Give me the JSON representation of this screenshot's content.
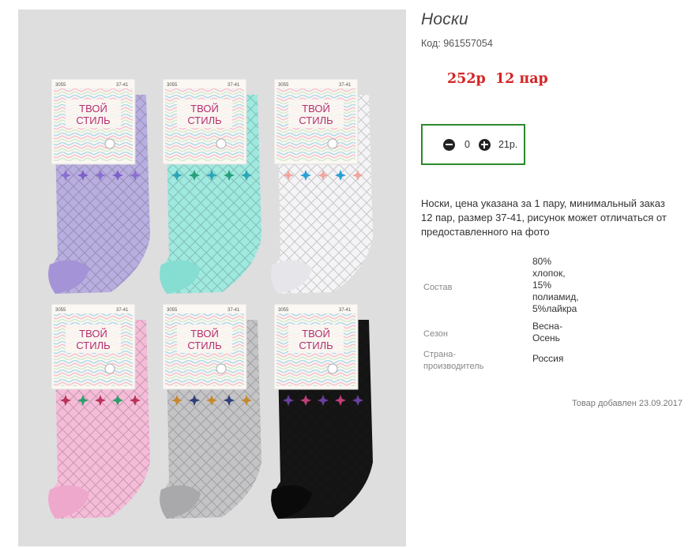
{
  "product": {
    "title": "Носки",
    "code": "Код: 961557054",
    "price": "252р  12 пар",
    "quantity": "0",
    "unit_price": "21р.",
    "description": "Носки, цена указана за 1 пару, минимальный заказ 12 пар, размер 37-41, рисунок может отличаться от предоставленного на фото",
    "specs": [
      {
        "label": "Состав",
        "value": "80%\nхлопок,\n15%\nполиамид,\n5%лайкра"
      },
      {
        "label": "Сезон",
        "value": "Весна-\nОсень"
      },
      {
        "label": "Страна-\nпроизводитель",
        "value": "Россия"
      }
    ],
    "added": "Товар добавлен 23.09.2017"
  },
  "photo": {
    "alt_brand": "ТВОЙ СТИЛЬ",
    "article": "3055",
    "size": "37-41",
    "socks": [
      {
        "color": "#b9aee0",
        "heel": "#a493d6"
      },
      {
        "color": "#9fe9df",
        "heel": "#86ddd2"
      },
      {
        "color": "#f4f4f6",
        "heel": "#e6e6ea"
      },
      {
        "color": "#f5bcd8",
        "heel": "#eea8cc"
      },
      {
        "color": "#c4c4c6",
        "heel": "#a9a9ab"
      },
      {
        "color": "#151515",
        "heel": "#0a0a0a"
      }
    ]
  },
  "colors": {
    "price": "#d42424",
    "qty_border": "#2b8a2b"
  },
  "icons": {
    "minus": "minus-circle-icon",
    "plus": "plus-circle-icon"
  }
}
